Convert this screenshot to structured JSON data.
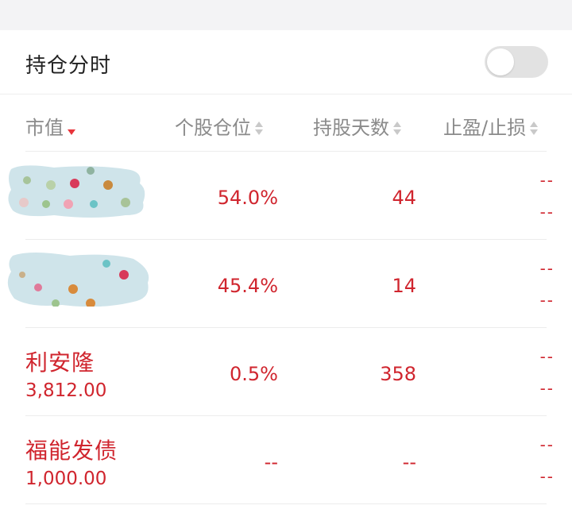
{
  "topbar": {
    "title": "持仓分时",
    "toggle_on": false
  },
  "columns": {
    "market_value": "市值",
    "position": "个股仓位",
    "days": "持股天数",
    "tp_sl": "止盈/止损"
  },
  "colors": {
    "accent": "#d0252e",
    "toggle_off": "#e2e2e2"
  },
  "rows": [
    {
      "name": "",
      "value": "",
      "position": "54.0%",
      "days": "44",
      "take_profit": "--",
      "stop_loss": "--",
      "obscured": true
    },
    {
      "name": "",
      "value": "",
      "position": "45.4%",
      "days": "14",
      "take_profit": "--",
      "stop_loss": "--",
      "obscured": true
    },
    {
      "name": "利安隆",
      "value": "3,812.00",
      "position": "0.5%",
      "days": "358",
      "take_profit": "--",
      "stop_loss": "--",
      "obscured": false
    },
    {
      "name": "福能发债",
      "value": "1,000.00",
      "position": "--",
      "days": "--",
      "take_profit": "--",
      "stop_loss": "--",
      "obscured": false
    }
  ]
}
